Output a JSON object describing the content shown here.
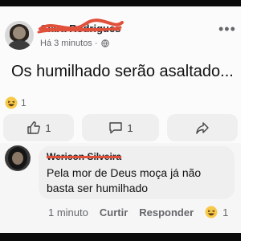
{
  "post": {
    "author_name": "Clara Rodrigues",
    "time": "Há 3 minutos ·",
    "privacy_icon": "globe-icon",
    "more_icon": "more-options-icon",
    "text": "Os humilhado serão asaltado...",
    "reaction_emoji": "haha-emoji",
    "reaction_count": "1"
  },
  "actions": {
    "like_icon": "thumbs-up-icon",
    "like_count": "1",
    "comment_icon": "comment-icon",
    "comment_count": "1",
    "share_icon": "share-icon"
  },
  "comment": {
    "author_name": "Wericon Silveira",
    "text": "Pela mor de Deus moça já não basta ser humilhado",
    "time": "1 minuto",
    "like_label": "Curtir",
    "reply_label": "Responder",
    "reaction_emoji": "haha-emoji",
    "reaction_count": "1"
  },
  "colors": {
    "redaction": "#e0503a",
    "button_bg": "#efefef",
    "secondary_text": "#65676b"
  }
}
